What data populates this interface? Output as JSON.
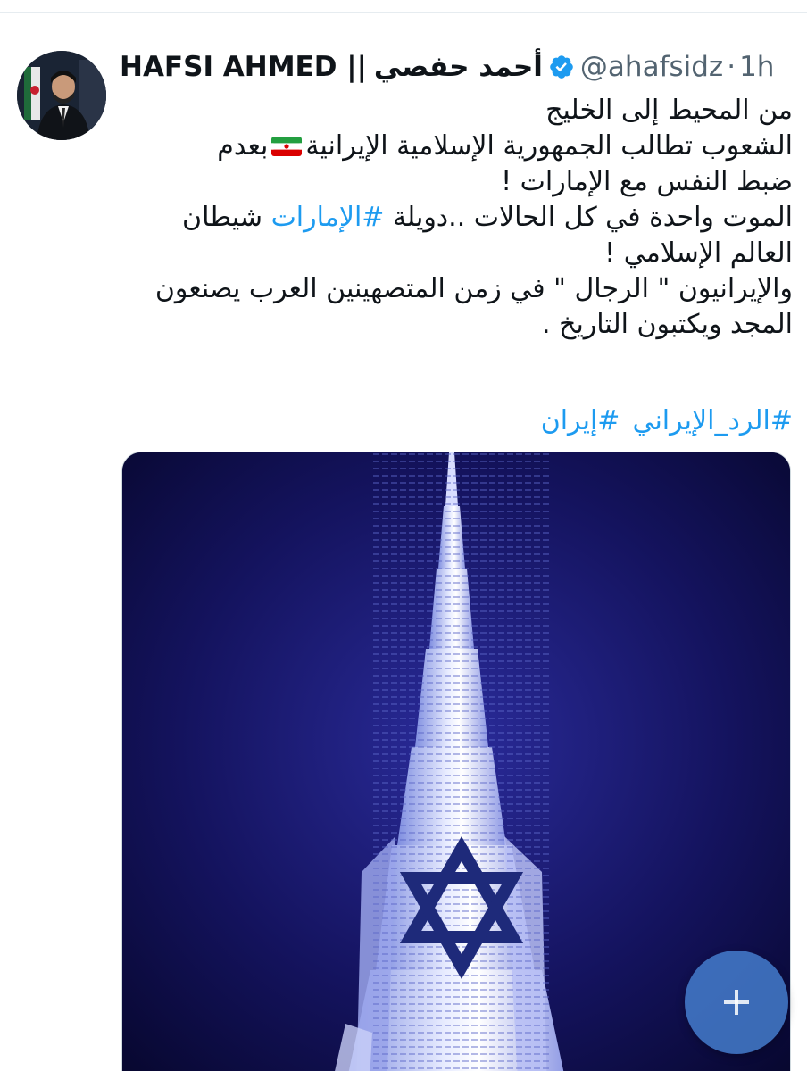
{
  "tweet": {
    "author": {
      "name_latin": "HAFSI AHMED ||",
      "name_arabic": "أحمد حفصي",
      "handle": "@ahafsidz",
      "separator": "·",
      "time": "1h",
      "verified": true
    },
    "text_lines": {
      "l1": "من المحيط إلى الخليج",
      "l2_a": "الشعوب تطالب الجمهورية الإسلامية الإيرانية",
      "l2_b": "بعدم",
      "l3": "ضبط النفس مع الإمارات   !",
      "l4_a": "الموت واحدة في كل الحالات  ..دويلة ",
      "l4_tag": "#الإمارات",
      "l4_b": " شيطان",
      "l5": "العالم الإسلامي !",
      "l6": "والإيرانيون  \" الرجال \" في زمن المتصهينين العرب يصنعون",
      "l7": "المجد ويكتبون التاريخ ."
    },
    "flag_icon": "iran-flag-emoji",
    "hashtags": [
      "#الرد_الإيراني",
      "#إيران"
    ],
    "media": {
      "description_icon": "tower-with-star-of-david-image"
    }
  },
  "fab": {
    "icon": "plus-icon",
    "color": "#4986d8"
  },
  "colors": {
    "text": "#0f1419",
    "secondary": "#536471",
    "link": "#1d9bf0",
    "verified": "#1d9bf0"
  }
}
